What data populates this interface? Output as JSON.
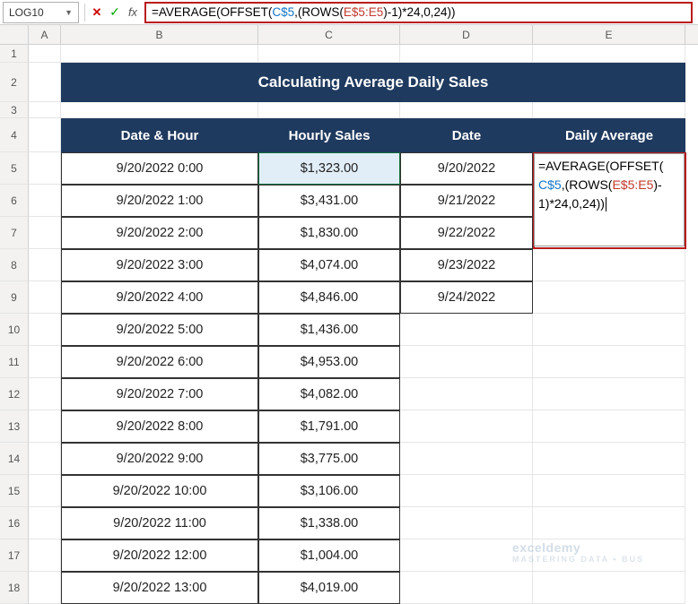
{
  "formula_bar": {
    "name_box": "LOG10",
    "formula_parts": {
      "p0": "=AVERAGE(OFFSET(",
      "p1": "C$5",
      "p2": ",(ROWS(",
      "p3": "E$5:E5",
      "p4": ")-1)*24,0,24))"
    }
  },
  "columns": {
    "A": "A",
    "B": "B",
    "C": "C",
    "D": "D",
    "E": "E"
  },
  "rows": [
    "1",
    "2",
    "3",
    "4",
    "5",
    "6",
    "7",
    "8",
    "9",
    "10",
    "11",
    "12",
    "13",
    "14",
    "15",
    "16",
    "17",
    "18"
  ],
  "title": "Calculating Average Daily Sales",
  "headers": {
    "dateHour": "Date & Hour",
    "hourlySales": "Hourly Sales",
    "date": "Date",
    "dailyAvg": "Daily Average"
  },
  "data_rows": [
    {
      "dh": "9/20/2022 0:00",
      "hs": "$1,323.00",
      "d": "9/20/2022"
    },
    {
      "dh": "9/20/2022 1:00",
      "hs": "$3,431.00",
      "d": "9/21/2022"
    },
    {
      "dh": "9/20/2022 2:00",
      "hs": "$1,830.00",
      "d": "9/22/2022"
    },
    {
      "dh": "9/20/2022 3:00",
      "hs": "$4,074.00",
      "d": "9/23/2022"
    },
    {
      "dh": "9/20/2022 4:00",
      "hs": "$4,846.00",
      "d": "9/24/2022"
    },
    {
      "dh": "9/20/2022 5:00",
      "hs": "$1,436.00",
      "d": ""
    },
    {
      "dh": "9/20/2022 6:00",
      "hs": "$4,953.00",
      "d": ""
    },
    {
      "dh": "9/20/2022 7:00",
      "hs": "$4,082.00",
      "d": ""
    },
    {
      "dh": "9/20/2022 8:00",
      "hs": "$1,791.00",
      "d": ""
    },
    {
      "dh": "9/20/2022 9:00",
      "hs": "$3,775.00",
      "d": ""
    },
    {
      "dh": "9/20/2022 10:00",
      "hs": "$3,106.00",
      "d": ""
    },
    {
      "dh": "9/20/2022 11:00",
      "hs": "$1,338.00",
      "d": ""
    },
    {
      "dh": "9/20/2022 12:00",
      "hs": "$1,004.00",
      "d": ""
    },
    {
      "dh": "9/20/2022 13:00",
      "hs": "$4,019.00",
      "d": ""
    }
  ],
  "inline_formula": {
    "p0": "=AVERAGE(OFFSET(",
    "p1": "C$5",
    "p2": ",(ROWS(",
    "p3": "E$5:E5",
    "p4": ")-",
    "p5": "1)*24,0,24))"
  },
  "watermark": {
    "main": "exceldemy",
    "sub": "MASTERING DATA • BUS"
  }
}
